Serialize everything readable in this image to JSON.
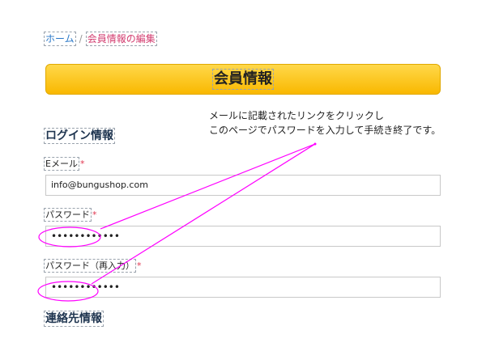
{
  "breadcrumb": {
    "home": "ホーム",
    "separator": "/",
    "current": "会員情報の編集"
  },
  "banner": {
    "title": "会員情報"
  },
  "annotation": {
    "line1": "メールに記載されたリンクをクリックし",
    "line2": "このページでパスワードを入力して手続き終了です。",
    "color": "#ff00ff"
  },
  "login_section": {
    "heading": "ログイン情報",
    "email": {
      "label": "Eメール",
      "required": "*",
      "value": "info@bungushop.com"
    },
    "password": {
      "label": "パスワード",
      "required": "*",
      "value": "••••••••••••"
    },
    "password_confirm": {
      "label": "パスワード（再入力）",
      "required": "*",
      "value": "••••••••••••"
    }
  },
  "contact_section": {
    "heading": "連絡先情報"
  },
  "colors": {
    "banner": "#ffc61a",
    "link": "#2a78c8",
    "current_crumb": "#d23a6e",
    "required": "#e0364f"
  }
}
